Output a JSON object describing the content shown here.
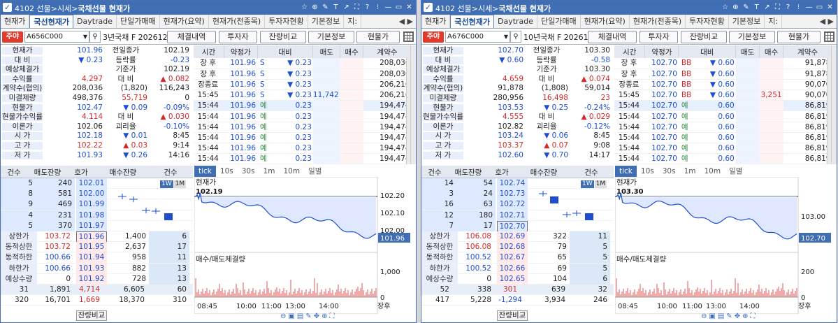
{
  "windows": [
    {
      "title_prefix": "4102  선물>시세>",
      "title_main": "국채선물 현재가",
      "tabs": [
        "현재가",
        "국선현재가",
        "Daytrade",
        "단일가매매",
        "현재가(요약)",
        "현재가(전종목)",
        "투자자현황",
        "기본정보",
        "지:"
      ],
      "active_tab": 1,
      "code": "A656C000",
      "name": "3년국채 F 202612",
      "buttons": [
        "체결내역",
        "투자자",
        "잔량비교",
        "기본정보",
        "현물가"
      ],
      "info": [
        {
          "l": "현재가",
          "v": "101.96",
          "vc": "blue",
          "l2": "전일종가",
          "v2": "102.19",
          "v2c": "blk"
        },
        {
          "l": "대  비",
          "v": "▼  0.23",
          "vc": "blue",
          "l2": "등락률",
          "v2": "-0.23",
          "v2c": "blue"
        },
        {
          "l": "예상체결가",
          "v": "",
          "vc": "blk",
          "l2": "기준가",
          "v2": "102.19",
          "v2c": "blk"
        },
        {
          "l": "수익률",
          "v": "4.297",
          "vc": "red",
          "l2": "대  비",
          "v2": "▲  0.082",
          "v2c": "red"
        },
        {
          "l": "계약수(협의)",
          "v": "208,036",
          "vc": "blk",
          "l2": "(1,820)",
          "v2": "116,243",
          "v2c": "blk",
          "l2free": true
        },
        {
          "l": "미결제량",
          "v": "498,376",
          "vc": "blk",
          "l2": "55,719",
          "v2": "0",
          "v2c": "blk",
          "l2free": true,
          "l2c": "red"
        },
        {
          "l": "현물가",
          "v": "102.47",
          "vc": "blue",
          "l2": "▼  0.09",
          "v2": "-0.09%",
          "v2c": "blue",
          "l2free": true,
          "l2c": "blue"
        },
        {
          "l": "현물가수익률",
          "v": "4.114",
          "vc": "red",
          "l2": "대  비",
          "v2": "▲  0.030",
          "v2c": "red"
        },
        {
          "l": "이론가",
          "v": "102.06",
          "vc": "blk",
          "l2": "괴리율",
          "v2": "-0.10%",
          "v2c": "blue"
        },
        {
          "l": "시  가",
          "v": "102.18",
          "vc": "blue",
          "l2": "▼  0.01",
          "v2": "8:45",
          "v2c": "blk",
          "l2free": true,
          "l2c": "blue"
        },
        {
          "l": "고  가",
          "v": "102.22",
          "vc": "red",
          "l2": "▲  0.03",
          "v2": "9:14",
          "v2c": "blk",
          "l2free": true,
          "l2c": "red"
        },
        {
          "l": "저  가",
          "v": "101.93",
          "vc": "blue",
          "l2": "▼  0.26",
          "v2": "14:16",
          "v2c": "blk",
          "l2free": true,
          "l2c": "blue"
        }
      ],
      "trade_head": [
        "시간",
        "약정가",
        "대비",
        "매도",
        "매수",
        "계약수"
      ],
      "trades": [
        {
          "t": "장 후",
          "p": "101.96",
          "f": "S",
          "d": "▼  0.23",
          "s": "",
          "b": "",
          "v": "208,036"
        },
        {
          "t": "장 후",
          "p": "101.96",
          "f": "S",
          "d": "▼  0.23",
          "s": "",
          "b": "",
          "v": "208,036"
        },
        {
          "t": "장종료",
          "p": "101.96",
          "f": "S",
          "d": "▼  0.23",
          "s": "",
          "b": "",
          "v": "206,216"
        },
        {
          "t": "15:45",
          "p": "101.96",
          "f": "S",
          "d": "▼  0.23",
          "s": "11,742",
          "b": "",
          "v": "206,216"
        },
        {
          "t": "15:44",
          "p": "101.96",
          "f": "예",
          "d": "0.23",
          "s": "",
          "b": "",
          "v": "194,474"
        },
        {
          "t": "15:44",
          "p": "101.96",
          "f": "예",
          "d": "0.23",
          "s": "",
          "b": "",
          "v": "194,474"
        },
        {
          "t": "15:44",
          "p": "101.96",
          "f": "예",
          "d": "0.23",
          "s": "",
          "b": "",
          "v": "194,474"
        },
        {
          "t": "15:44",
          "p": "101.96",
          "f": "예",
          "d": "0.23",
          "s": "",
          "b": "",
          "v": "194,474"
        },
        {
          "t": "15:44",
          "p": "101.96",
          "f": "예",
          "d": "0.23",
          "s": "",
          "b": "",
          "v": "194,474"
        },
        {
          "t": "15:44",
          "p": "101.96",
          "f": "예",
          "d": "0.23",
          "s": "",
          "b": "",
          "v": "194,474"
        }
      ],
      "ob_head": [
        "건수",
        "매도잔량",
        "호가",
        "매수잔량",
        "건수"
      ],
      "asks": [
        [
          "5",
          "240",
          "102.01"
        ],
        [
          "8",
          "581",
          "102.00"
        ],
        [
          "9",
          "469",
          "101.99"
        ],
        [
          "4",
          "231",
          "101.98"
        ],
        [
          "5",
          "370",
          "101.97"
        ]
      ],
      "bids": [
        {
          "lab": "상한가",
          "lv": "103.72",
          "lvc": "red",
          "p": "101.96",
          "q": "1,400",
          "n": "6"
        },
        {
          "lab": "동적상한",
          "lv": "103.72",
          "lvc": "red",
          "p": "101.95",
          "q": "2,637",
          "n": "17"
        },
        {
          "lab": "동적하한",
          "lv": "100.66",
          "lvc": "blue",
          "p": "101.94",
          "q": "958",
          "n": "11"
        },
        {
          "lab": "하한가",
          "lv": "100.66",
          "lvc": "blue",
          "p": "101.93",
          "q": "882",
          "n": "13"
        },
        {
          "lab": "예상수량",
          "lv": "0",
          "lvc": "blk",
          "p": "101.92",
          "q": "728",
          "n": "13"
        }
      ],
      "tot1": [
        "31",
        "1,891",
        "4,714",
        "6,605",
        "60"
      ],
      "tot1c": "red",
      "tot2": [
        "320",
        "16,701",
        "1,669",
        "18,370",
        "310"
      ],
      "tot2c": "red",
      "footer": "잔량비교",
      "week_btns": [
        "1W",
        "1M"
      ],
      "chart_tabs": [
        "tick",
        "10s",
        "30s",
        "1m",
        "10m",
        "일별"
      ],
      "chart_title": "현재가",
      "chart_prev": "102.19",
      "chart_price": "101.96",
      "chart_y": [
        "102.20",
        "102.10",
        "102.00"
      ],
      "vol_title": "매수/매도체결량",
      "vol_y": [
        "1,000",
        "0"
      ],
      "x_ticks": [
        "08:45",
        "10:00",
        "11:00",
        "13:00",
        "14:00",
        "장후"
      ]
    },
    {
      "title_prefix": "4102  선물>시세>",
      "title_main": "국채선물 현재가",
      "tabs": [
        "현재가",
        "국선현재가",
        "Daytrade",
        "단일가매매",
        "현재가(요약)",
        "현재가(전종목)",
        "투자자현황",
        "기본정보",
        "지:"
      ],
      "active_tab": 1,
      "code": "A676C000",
      "name": "10년국채 F 202612",
      "buttons": [
        "체결내역",
        "투자자",
        "잔량비교",
        "기본정보",
        "현물가"
      ],
      "info": [
        {
          "l": "현재가",
          "v": "102.70",
          "vc": "blue",
          "l2": "전일종가",
          "v2": "103.30",
          "v2c": "blk"
        },
        {
          "l": "대  비",
          "v": "▼  0.60",
          "vc": "blue",
          "l2": "등락률",
          "v2": "-0.58",
          "v2c": "blue"
        },
        {
          "l": "예상체결가",
          "v": "",
          "vc": "blk",
          "l2": "기준가",
          "v2": "103.30",
          "v2c": "blk"
        },
        {
          "l": "수익률",
          "v": "4.659",
          "vc": "red",
          "l2": "대  비",
          "v2": "▲  0.074",
          "v2c": "red"
        },
        {
          "l": "계약수(협의)",
          "v": "91,878",
          "vc": "blk",
          "l2": "(1,808)",
          "v2": "59,014",
          "v2c": "blk",
          "l2free": true
        },
        {
          "l": "미결제량",
          "v": "280,956",
          "vc": "blk",
          "l2": "16,498",
          "v2": "23",
          "v2c": "red",
          "l2free": true,
          "l2c": "red"
        },
        {
          "l": "현물가",
          "v": "103.53",
          "vc": "blue",
          "l2": "▼  0.25",
          "v2": "-0.24%",
          "v2c": "blue",
          "l2free": true,
          "l2c": "blue"
        },
        {
          "l": "현물가수익률",
          "v": "4.555",
          "vc": "red",
          "l2": "대  비",
          "v2": "▲  0.029",
          "v2c": "red"
        },
        {
          "l": "이론가",
          "v": "102.82",
          "vc": "blk",
          "l2": "괴리율",
          "v2": "-0.12%",
          "v2c": "blue"
        },
        {
          "l": "시  가",
          "v": "103.24",
          "vc": "blue",
          "l2": "▼  0.06",
          "v2": "8:45",
          "v2c": "blk",
          "l2free": true,
          "l2c": "blue"
        },
        {
          "l": "고  가",
          "v": "103.37",
          "vc": "red",
          "l2": "▲  0.07",
          "v2": "9:08",
          "v2c": "blk",
          "l2free": true,
          "l2c": "red"
        },
        {
          "l": "저  가",
          "v": "102.60",
          "vc": "blue",
          "l2": "▼  0.70",
          "v2": "14:17",
          "v2c": "blk",
          "l2free": true,
          "l2c": "blue"
        }
      ],
      "trade_head": [
        "시간",
        "약정가",
        "대비",
        "매도",
        "매수",
        "계약수"
      ],
      "trades": [
        {
          "t": "장 후",
          "p": "102.70",
          "f": "BB",
          "d": "▼  0.60",
          "s": "",
          "b": "",
          "v": "91,878"
        },
        {
          "t": "장 후",
          "p": "102.70",
          "f": "BB",
          "d": "▼  0.60",
          "s": "",
          "b": "",
          "v": "91,878"
        },
        {
          "t": "장종료",
          "p": "102.70",
          "f": "BB",
          "d": "▼  0.60",
          "s": "",
          "b": "",
          "v": "90,070"
        },
        {
          "t": "15:45",
          "p": "102.70",
          "f": "BB",
          "d": "▼  0.60",
          "s": "",
          "b": "3,251",
          "v": "90,070"
        },
        {
          "t": "15:44",
          "p": "102.70",
          "f": "예",
          "d": "0.60",
          "s": "",
          "b": "",
          "v": "86,819"
        },
        {
          "t": "15:44",
          "p": "102.70",
          "f": "예",
          "d": "0.60",
          "s": "",
          "b": "",
          "v": "86,819"
        },
        {
          "t": "15:44",
          "p": "102.70",
          "f": "예",
          "d": "0.60",
          "s": "",
          "b": "",
          "v": "86,819"
        },
        {
          "t": "15:44",
          "p": "102.70",
          "f": "예",
          "d": "0.60",
          "s": "",
          "b": "",
          "v": "86,819"
        },
        {
          "t": "15:44",
          "p": "102.70",
          "f": "예",
          "d": "0.60",
          "s": "",
          "b": "",
          "v": "86,819"
        },
        {
          "t": "15:44",
          "p": "102.70",
          "f": "예",
          "d": "0.60",
          "s": "",
          "b": "",
          "v": "86,819"
        }
      ],
      "ob_head": [
        "건수",
        "매도잔량",
        "호가",
        "매수잔량",
        "건수"
      ],
      "asks": [
        [
          "14",
          "54",
          "102.74"
        ],
        [
          "3",
          "24",
          "102.73"
        ],
        [
          "16",
          "63",
          "102.72"
        ],
        [
          "12",
          "180",
          "102.71"
        ],
        [
          "7",
          "17",
          "102.70"
        ]
      ],
      "bids": [
        {
          "lab": "상한가",
          "lv": "106.08",
          "lvc": "red",
          "p": "102.69",
          "q": "322",
          "n": "11"
        },
        {
          "lab": "동적상한",
          "lv": "106.08",
          "lvc": "red",
          "p": "102.68",
          "q": "79",
          "n": "5"
        },
        {
          "lab": "동적하한",
          "lv": "100.52",
          "lvc": "blue",
          "p": "102.67",
          "q": "65",
          "n": "5"
        },
        {
          "lab": "하한가",
          "lv": "100.52",
          "lvc": "blue",
          "p": "102.66",
          "q": "69",
          "n": "5"
        },
        {
          "lab": "예상수량",
          "lv": "0",
          "lvc": "blk",
          "p": "102.65",
          "q": "104",
          "n": "6"
        }
      ],
      "tot1": [
        "52",
        "338",
        "301",
        "639",
        "32"
      ],
      "tot1c": "red",
      "tot2": [
        "417",
        "5,228",
        "-1,294",
        "3,934",
        "246"
      ],
      "tot2c": "blue",
      "footer": "잔량비교",
      "week_btns": [
        "1W",
        "1M"
      ],
      "chart_tabs": [
        "tick",
        "10s",
        "30s",
        "1m",
        "10m",
        "일별"
      ],
      "chart_title": "현재가",
      "chart_prev": "103.30",
      "chart_price": "102.70",
      "chart_y": [
        "103.00"
      ],
      "vol_title": "매수/매도체결량",
      "vol_y": [
        "200",
        "0"
      ],
      "x_ticks": [
        "08:45",
        "10:00",
        "11:00",
        "13:00",
        "14:00",
        "장후"
      ]
    }
  ]
}
